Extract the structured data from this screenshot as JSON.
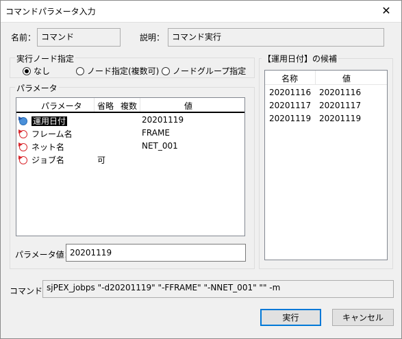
{
  "window": {
    "title": "コマンドパラメータ入力",
    "close_glyph": "✕"
  },
  "header": {
    "name_label": "名前：",
    "name_value": "コマンド",
    "desc_label": "説明：",
    "desc_value": "コマンド実行"
  },
  "node_group": {
    "legend": "実行ノード指定",
    "options": [
      {
        "label": "なし",
        "selected": true
      },
      {
        "label": "ノード指定(複数可)",
        "selected": false
      },
      {
        "label": "ノードグループ指定",
        "selected": false
      }
    ]
  },
  "param_group": {
    "legend": "パラメータ",
    "columns": [
      "パラメータ",
      "省略",
      "複数",
      "値"
    ],
    "rows": [
      {
        "name": "運用日付",
        "omit": "",
        "multi": "",
        "value": "20201119",
        "icon": "blue-param-icon",
        "selected": true
      },
      {
        "name": "フレーム名",
        "omit": "",
        "multi": "",
        "value": "FRAME",
        "icon": "red-flag-param-icon",
        "selected": false
      },
      {
        "name": "ネット名",
        "omit": "",
        "multi": "",
        "value": "NET_001",
        "icon": "red-flag-param-icon",
        "selected": false
      },
      {
        "name": "ジョブ名",
        "omit": "可",
        "multi": "",
        "value": "",
        "icon": "red-flag-param-icon",
        "selected": false
      }
    ],
    "value_label": "パラメータ値：",
    "value_input": "20201119"
  },
  "candidates": {
    "legend": "【運用日付】の候補",
    "columns": [
      "名称",
      "値"
    ],
    "rows": [
      {
        "name": "20201116",
        "value": "20201116"
      },
      {
        "name": "20201117",
        "value": "20201117"
      },
      {
        "name": "20201119",
        "value": "20201119"
      }
    ]
  },
  "command": {
    "label": "コマンド：",
    "value": "sjPEX_jobps \"-d20201119\" \"-FFRAME\" \"-NNET_001\" \"\" -m"
  },
  "buttons": {
    "run": "実行",
    "cancel": "キャンセル"
  },
  "colors": {
    "accent": "#0078d7",
    "blue_icon": "#4a90d9",
    "red_flag": "#d9262c"
  }
}
